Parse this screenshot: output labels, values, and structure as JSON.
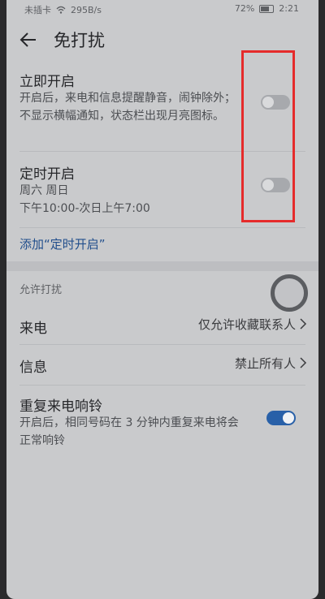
{
  "statusbar": {
    "carrier": "未插卡",
    "speed": "295B/s",
    "battery": "72%",
    "time": "2:21"
  },
  "header": {
    "title": "免打扰"
  },
  "immediate": {
    "title": "立即开启",
    "desc": "开启后，来电和信息提醒静音，闹钟除外；不显示横幅通知，状态栏出现月亮图标。",
    "enabled": false
  },
  "scheduled": {
    "title": "定时开启",
    "days": "周六 周日",
    "time": "下午10:00-次日上午7:00",
    "enabled": false
  },
  "add_link": "添加“定时开启”",
  "allow": {
    "section_label": "允许打扰",
    "calls": {
      "label": "来电",
      "value": "仅允许收藏联系人"
    },
    "messages": {
      "label": "信息",
      "value": "禁止所有人"
    }
  },
  "repeat": {
    "title": "重复来电响铃",
    "desc": "开启后，相同号码在 3 分钟内重复来电将会正常响铃",
    "enabled": true
  },
  "colors": {
    "accent": "#2860a8",
    "highlight": "#e52b2b"
  }
}
